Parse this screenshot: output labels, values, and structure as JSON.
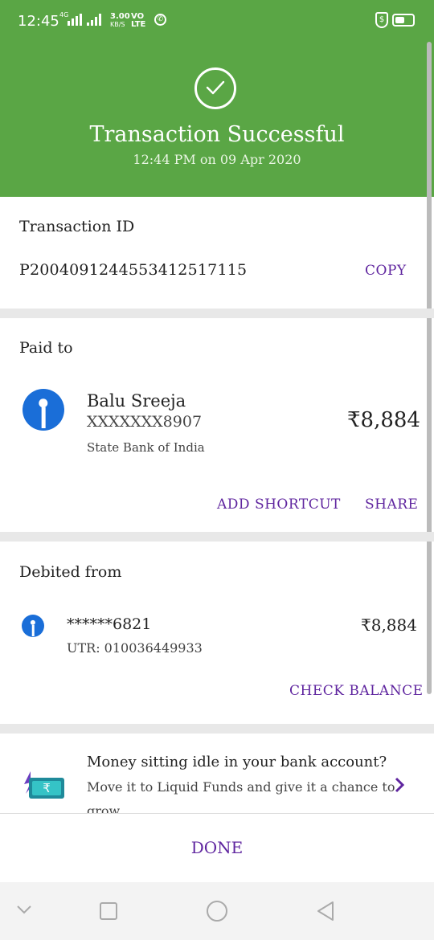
{
  "status_bar": {
    "time": "12:45",
    "network_type": "4G",
    "speed": "3.00",
    "speed_unit": "KB/S",
    "volte": "VO",
    "lte": "LTE",
    "battery_icon": "battery-icon",
    "whatsapp_icon": "whatsapp-icon"
  },
  "header": {
    "title": "Transaction Successful",
    "subtitle": "12:44 PM on 09 Apr 2020",
    "color": "#5aa645"
  },
  "transaction": {
    "label": "Transaction ID",
    "id": "P2004091244553412517115",
    "copy_label": "COPY"
  },
  "paid_to": {
    "label": "Paid to",
    "name": "Balu Sreeja",
    "account": "XXXXXXX8907",
    "bank": "State Bank of India",
    "amount": "₹8,884",
    "add_shortcut_label": "ADD SHORTCUT",
    "share_label": "SHARE"
  },
  "debited_from": {
    "label": "Debited from",
    "account": "******6821",
    "utr": "UTR: 010036449933",
    "amount": "₹8,884",
    "check_balance_label": "CHECK BALANCE"
  },
  "promo": {
    "title": "Money sitting idle in your bank account?",
    "body": "Move it to Liquid Funds and give it a chance to",
    "body_overflow": "grow"
  },
  "done_label": "DONE",
  "accent_color": "#5f259f"
}
